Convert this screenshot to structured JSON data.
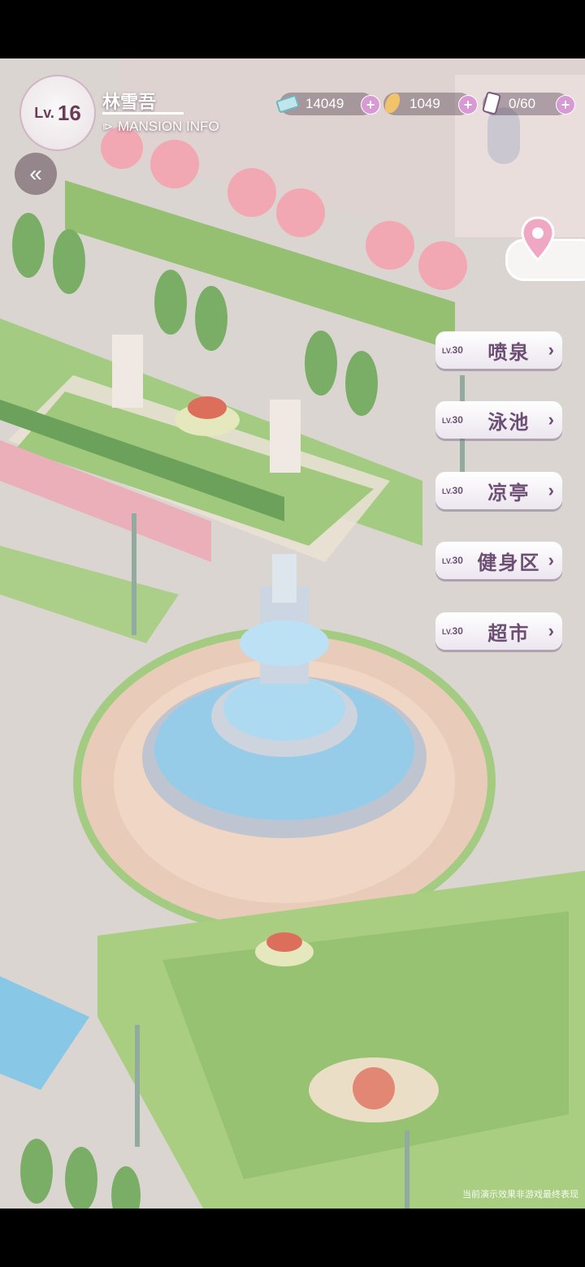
{
  "player": {
    "level_prefix": "Lv.",
    "level": "16",
    "name": "林雪吾",
    "mansion_info_label": "MANSION INFO"
  },
  "resources": [
    {
      "icon": "cash-icon",
      "value": "14049"
    },
    {
      "icon": "feather-icon",
      "value": "1049"
    },
    {
      "icon": "phone-energy-icon",
      "value": "0/60"
    }
  ],
  "facilities": [
    {
      "level_prefix": "LV.",
      "level": "30",
      "name": "喷泉"
    },
    {
      "level_prefix": "LV.",
      "level": "30",
      "name": "泳池"
    },
    {
      "level_prefix": "LV.",
      "level": "30",
      "name": "凉亭"
    },
    {
      "level_prefix": "LV.",
      "level": "30",
      "name": "健身区"
    },
    {
      "level_prefix": "LV.",
      "level": "30",
      "name": "超市"
    }
  ],
  "disclaimer": "当前演示效果非游戏最终表现",
  "colors": {
    "accent": "#d89ad2",
    "button_text": "#6d4f76",
    "lawn": "#8fbf6a",
    "water": "#8fc8e8"
  }
}
